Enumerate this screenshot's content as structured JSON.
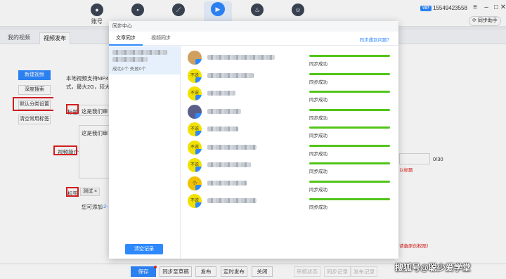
{
  "top_nav": {
    "items": [
      {
        "icon": "account-icon",
        "label": "账号",
        "active": false
      },
      {
        "icon": "chat-icon",
        "label": "",
        "active": false
      },
      {
        "icon": "compass-icon",
        "label": "",
        "active": false
      },
      {
        "icon": "video-play-icon",
        "label": "",
        "active": true
      },
      {
        "icon": "flame-icon",
        "label": "",
        "active": false
      },
      {
        "icon": "user-icon",
        "label": "",
        "active": false
      }
    ],
    "vip_label": "VIP",
    "account_number": "15549423558",
    "sync_assistant_label": "同步助手"
  },
  "page_tabs": [
    "我的视频",
    "视频发布"
  ],
  "sidebar": {
    "new_video": "新建视频",
    "deep_search": "深度搜索",
    "default_category": "默认分类设置",
    "clear_tags": "清空常用标签"
  },
  "form": {
    "upload_hint_line1": "本地视频支持MP4",
    "upload_hint_line2": "式，最大2G，较大",
    "title_label": "标题",
    "title_value": "这是我们审",
    "desc_label": "视频简介",
    "desc_value": "这是我们审",
    "tags_label": "标签",
    "tag_chip": "测试 ×",
    "tag_hint": "您可添加",
    "tag_hint_count": "2-",
    "char_counter": "0/30",
    "red_hint": "以标题",
    "red_hint2": "请备原创权限）"
  },
  "bottom_bar": {
    "save": "保存",
    "sync_draft": "同步至草稿",
    "publish": "发布",
    "scheduled_publish": "定时发布",
    "close": "关闭",
    "review_status": "审核状态",
    "sync_records": "同步记录",
    "publish_records": "发布记录"
  },
  "dialog": {
    "title": "同步中心",
    "close_icon": "close-icon",
    "tabs": [
      "文章同步",
      "视频同步"
    ],
    "help_link": "同步遇到问题？",
    "record_stats": "成功1个 失败0个",
    "clear_records": "清空记录",
    "accounts": [
      {
        "avatar_text": "",
        "avatar_color": "#d0a060",
        "status": "同步成功",
        "progress": 1.0
      },
      {
        "avatar_text": "不说",
        "avatar_color": "#f2e100",
        "status": "同步成功",
        "progress": 1.0
      },
      {
        "avatar_text": "不说",
        "avatar_color": "#f2e100",
        "status": "同步成功",
        "progress": 1.0
      },
      {
        "avatar_text": "",
        "avatar_color": "#5a5f8a",
        "status": "同步成功",
        "progress": 1.0
      },
      {
        "avatar_text": "不说",
        "avatar_color": "#f2e100",
        "status": "同步成功",
        "progress": 1.0
      },
      {
        "avatar_text": "不说",
        "avatar_color": "#f2e100",
        "status": "同步成功",
        "progress": 1.0
      },
      {
        "avatar_text": "不说",
        "avatar_color": "#f2e100",
        "status": "同步成功",
        "progress": 1.0
      },
      {
        "avatar_text": "小",
        "avatar_color": "#f2c200",
        "status": "同步成功",
        "progress": 1.0
      },
      {
        "avatar_text": "不说",
        "avatar_color": "#f2e100",
        "status": "同步成功",
        "progress": 1.0
      }
    ]
  },
  "watermark": "搜狐号@聪少爱学堂",
  "colors": {
    "accent": "#2e89ff",
    "success": "#52c41a",
    "highlight": "#e02020"
  }
}
